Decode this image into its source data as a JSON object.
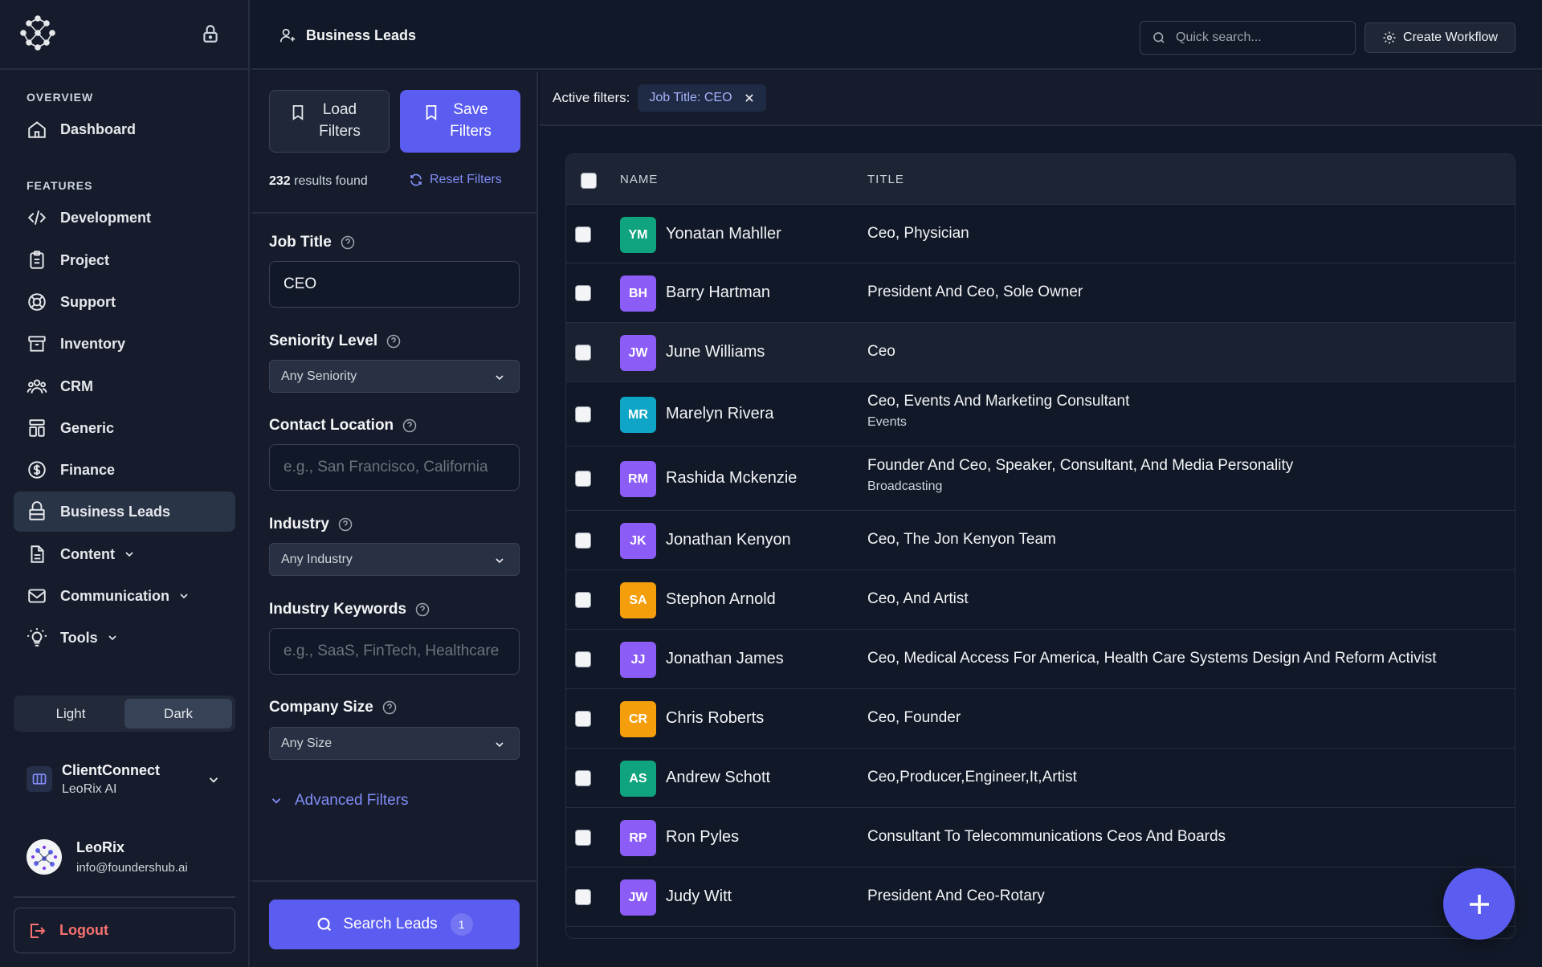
{
  "sidebar": {
    "sections": {
      "overview": "OVERVIEW",
      "features": "FEATURES"
    },
    "items": [
      {
        "label": "Dashboard",
        "icon": "home-icon"
      },
      {
        "label": "Development",
        "icon": "code-icon"
      },
      {
        "label": "Project",
        "icon": "clipboard-icon"
      },
      {
        "label": "Support",
        "icon": "lifebuoy-icon"
      },
      {
        "label": "Inventory",
        "icon": "archive-icon"
      },
      {
        "label": "CRM",
        "icon": "users-icon"
      },
      {
        "label": "Generic",
        "icon": "layout-icon"
      },
      {
        "label": "Finance",
        "icon": "dollar-icon"
      },
      {
        "label": "Business Leads",
        "icon": "briefcase-icon",
        "active": true
      },
      {
        "label": "Content",
        "icon": "file-icon"
      },
      {
        "label": "Communication",
        "icon": "mail-icon"
      },
      {
        "label": "Tools",
        "icon": "bulb-icon"
      }
    ],
    "theme": {
      "light": "Light",
      "dark": "Dark",
      "selected": "Dark"
    },
    "workspace": {
      "name": "ClientConnect",
      "org": "LeoRix AI"
    },
    "user": {
      "name": "LeoRix",
      "email": "info@foundershub.ai"
    },
    "logout": "Logout"
  },
  "topbar": {
    "title": "Business Leads",
    "search_placeholder": "Quick search...",
    "create_workflow": "Create Workflow"
  },
  "filters": {
    "load_label": "Load Filters",
    "save_label": "Save Filters",
    "results_count": "232",
    "results_suffix": "results found",
    "reset_label": "Reset Filters",
    "job_title": {
      "label": "Job Title",
      "value": "CEO"
    },
    "seniority": {
      "label": "Seniority Level",
      "value": "Any Seniority"
    },
    "location": {
      "label": "Contact Location",
      "placeholder": "e.g., San Francisco, California"
    },
    "industry": {
      "label": "Industry",
      "value": "Any Industry"
    },
    "keywords": {
      "label": "Industry Keywords",
      "placeholder": "e.g., SaaS, FinTech, Healthcare"
    },
    "company_size": {
      "label": "Company Size",
      "value": "Any Size"
    },
    "advanced": "Advanced Filters",
    "search_button": "Search Leads",
    "search_count": "1"
  },
  "active_filters": {
    "label": "Active filters:",
    "chips": [
      "Job Title: CEO"
    ]
  },
  "table": {
    "columns": {
      "name": "NAME",
      "title": "TITLE"
    },
    "rows": [
      {
        "initials": "YM",
        "name": "Yonatan Mahller",
        "title": "Ceo, Physician",
        "sub": "",
        "color": "#10a37f"
      },
      {
        "initials": "BH",
        "name": "Barry Hartman",
        "title": "President And Ceo, Sole Owner",
        "sub": "",
        "color": "#8b5cf6"
      },
      {
        "initials": "JW",
        "name": "June Williams",
        "title": "Ceo",
        "sub": "",
        "color": "#8b5cf6"
      },
      {
        "initials": "MR",
        "name": "Marelyn Rivera",
        "title": "Ceo, Events And Marketing Consultant",
        "sub": "Events",
        "color": "#0ea5c6"
      },
      {
        "initials": "RM",
        "name": "Rashida Mckenzie",
        "title": "Founder And Ceo, Speaker, Consultant, And Media Personality",
        "sub": "Broadcasting",
        "color": "#8b5cf6"
      },
      {
        "initials": "JK",
        "name": "Jonathan Kenyon",
        "title": "Ceo, The Jon Kenyon Team",
        "sub": "",
        "color": "#8b5cf6"
      },
      {
        "initials": "SA",
        "name": "Stephon Arnold",
        "title": "Ceo, And Artist",
        "sub": "",
        "color": "#f59e0b"
      },
      {
        "initials": "JJ",
        "name": "Jonathan James",
        "title": "Ceo, Medical Access For America, Health Care Systems Design And Reform Activist",
        "sub": "",
        "color": "#8b5cf6"
      },
      {
        "initials": "CR",
        "name": "Chris Roberts",
        "title": "Ceo, Founder",
        "sub": "",
        "color": "#f59e0b"
      },
      {
        "initials": "AS",
        "name": "Andrew Schott",
        "title": "Ceo,Producer,Engineer,It,Artist",
        "sub": "",
        "color": "#10a37f"
      },
      {
        "initials": "RP",
        "name": "Ron Pyles",
        "title": "Consultant To Telecommunications Ceos And Boards",
        "sub": "",
        "color": "#8b5cf6"
      },
      {
        "initials": "JW",
        "name": "Judy Witt",
        "title": "President And Ceo-Rotary",
        "sub": "",
        "color": "#8b5cf6"
      }
    ]
  },
  "colors": {
    "accent": "#5b5cf0",
    "danger": "#f87171",
    "link": "#818cf8"
  }
}
